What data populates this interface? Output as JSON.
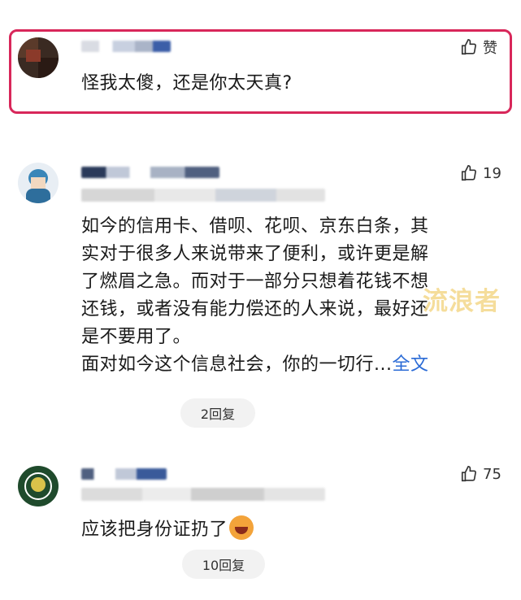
{
  "comments": [
    {
      "like_label": "赞",
      "text": "怪我太傻，还是你太天真?"
    },
    {
      "like_count": "19",
      "text_lines": [
        "如今的信用卡、借呗、花呗、京东白条，其",
        "实对于很多人来说带来了便利，或许更是解",
        "了燃眉之急。而对于一部分只想着花钱不想",
        "还钱，或者没有能力偿还的人来说，最好还",
        "是不要用了。",
        "面对如今这个信息社会，你的一切行..."
      ],
      "more_link": "全文",
      "replies": "2回复"
    },
    {
      "like_count": "75",
      "text": "应该把身份证扔了",
      "replies": "10回复"
    }
  ],
  "watermark": "流浪者",
  "colors": {
    "highlight_border": "#d8275a",
    "link": "#2b6bd6"
  }
}
